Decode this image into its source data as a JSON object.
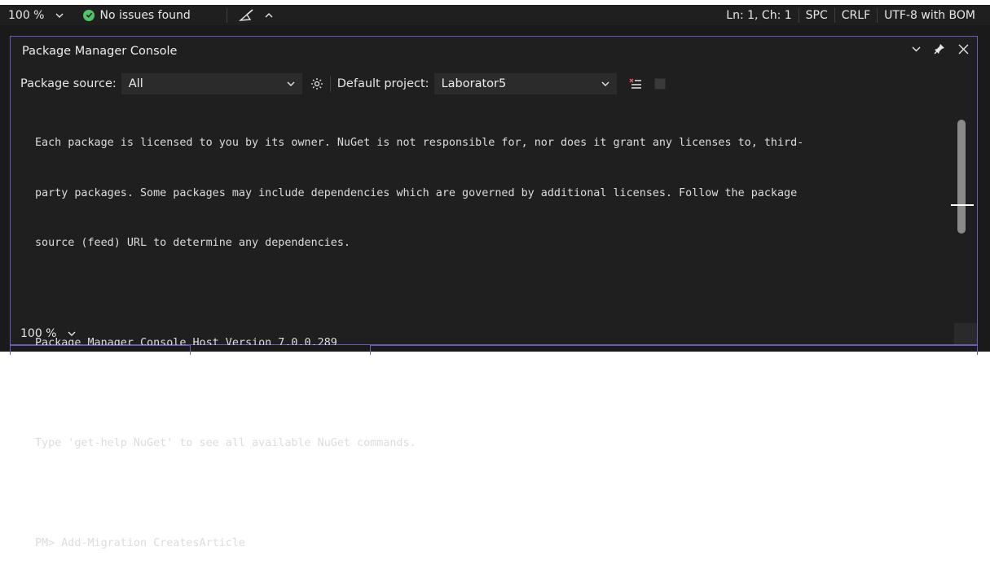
{
  "statusbar": {
    "zoom": "100 %",
    "issues": "No issues found",
    "position": "Ln: 1, Ch: 1",
    "whitespace": "SPC",
    "line_ending": "CRLF",
    "encoding": "UTF-8 with BOM"
  },
  "panel": {
    "title": "Package Manager Console",
    "toolbar": {
      "source_label": "Package source:",
      "source_value": "All",
      "project_label": "Default project:",
      "project_value": "Laborator5"
    },
    "console_lines": [
      "Each package is licensed to you by its owner. NuGet is not responsible for, nor does it grant any licenses to, third-",
      "party packages. Some packages may include dependencies which are governed by additional licenses. Follow the package",
      "source (feed) URL to determine any dependencies.",
      "",
      "Package Manager Console Host Version 7.0.0.289",
      "",
      "Type 'get-help NuGet' to see all available NuGet commands.",
      "",
      "PM> Add-Migration CreatesArticle"
    ],
    "zoom": "100 %"
  },
  "colors": {
    "accent": "#6e5bb5",
    "success": "#4ec36a",
    "background": "#1f1f1f"
  }
}
